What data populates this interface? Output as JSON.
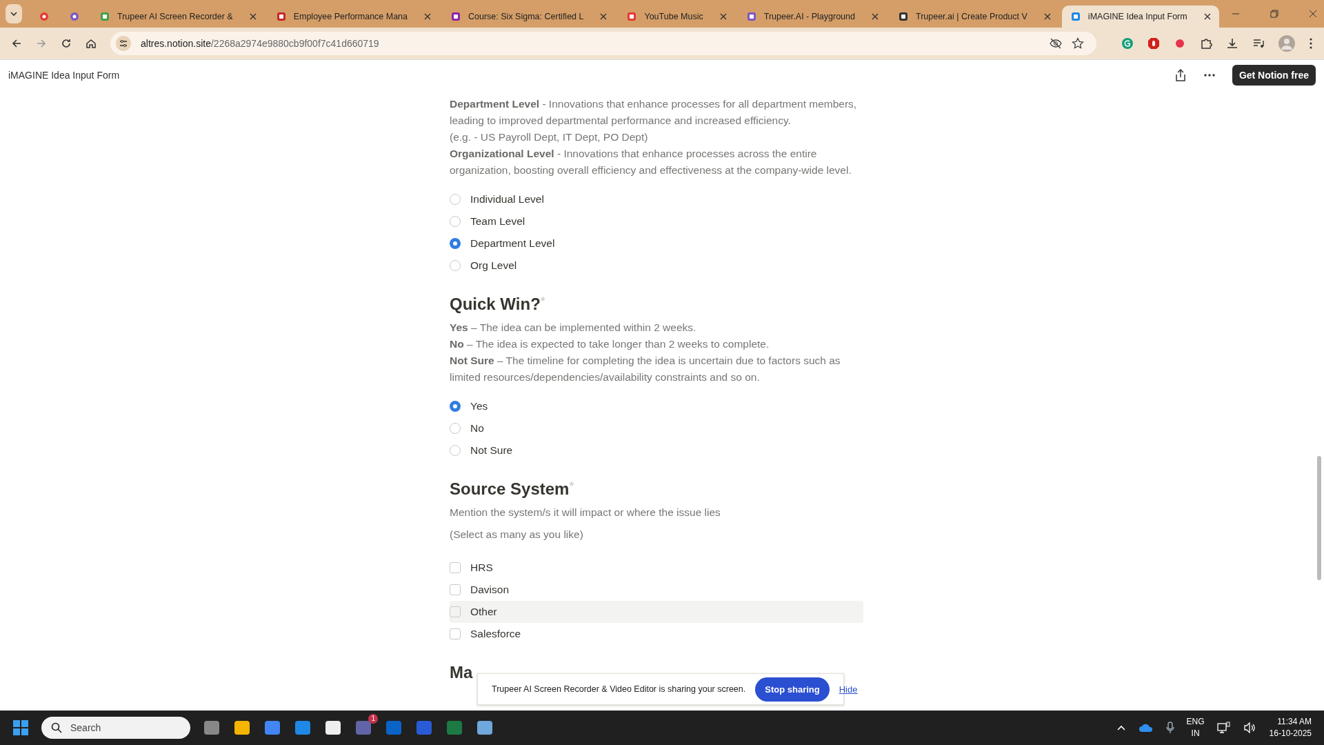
{
  "browser": {
    "tabs": [
      {
        "kind": "pinned",
        "selected": false
      },
      {
        "kind": "pinned",
        "selected": false
      },
      {
        "kind": "normal",
        "title": "Trupeer AI Screen Recorder &",
        "selected": false
      },
      {
        "kind": "normal",
        "title": "Employee Performance Mana",
        "selected": false
      },
      {
        "kind": "normal",
        "title": "Course: Six Sigma: Certified L",
        "selected": false
      },
      {
        "kind": "normal",
        "title": "YouTube Music",
        "selected": false
      },
      {
        "kind": "normal",
        "title": "Trupeer.AI - Playground",
        "selected": false
      },
      {
        "kind": "normal",
        "title": "Trupeer.ai | Create Product V",
        "selected": false
      },
      {
        "kind": "normal",
        "title": "iMAGINE Idea Input Form",
        "selected": true
      }
    ],
    "url_host": "altres.notion.site",
    "url_path": "/2268a2974e9880cb9f00f7c41d660719"
  },
  "page": {
    "title": "iMAGINE Idea Input Form",
    "cta": "Get Notion free"
  },
  "intro": [
    "**Department Level** - Innovations that enhance processes for all department members, leading to improved departmental performance and increased efficiency.",
    "(e.g. - US Payroll Dept, IT Dept, PO Dept)",
    "**Organizational Level** - Innovations that enhance processes across the entire organization, boosting overall efficiency and effectiveness at the company-wide level."
  ],
  "first_options": [
    {
      "label": "Individual Level",
      "selected": false
    },
    {
      "label": "Team Level",
      "selected": false
    },
    {
      "label": "Department Level",
      "selected": true
    },
    {
      "label": "Org Level",
      "selected": false
    }
  ],
  "questions": [
    {
      "kind": "radio",
      "title": "Quick Win?",
      "required_mark": "*",
      "description": [
        "**Yes** – The idea can be implemented within 2 weeks.",
        "**No** – The idea is expected to take longer than 2 weeks to complete.",
        "**Not Sure** – The timeline for completing the idea is uncertain due to factors such as limited resources/dependencies/availability constraints and so on."
      ],
      "options": [
        {
          "label": "Yes",
          "selected": true,
          "hovered": false
        },
        {
          "label": "No",
          "selected": false,
          "hovered": false
        },
        {
          "label": "Not Sure",
          "selected": false,
          "hovered": false
        }
      ]
    },
    {
      "kind": "checkbox",
      "title": "Source System",
      "required_mark": "*",
      "description": [
        "Mention the system/s it will impact or where the issue lies"
      ],
      "hint": "(Select as many as you like)",
      "options": [
        {
          "label": "HRS",
          "checked": false,
          "hovered": false
        },
        {
          "label": "Davison",
          "checked": false,
          "hovered": false
        },
        {
          "label": "Other",
          "checked": false,
          "hovered": true
        },
        {
          "label": "Salesforce",
          "checked": false,
          "hovered": false
        }
      ]
    }
  ],
  "next_heading": "Ma",
  "share_banner": {
    "message": "Trupeer AI Screen Recorder & Video Editor is sharing your screen.",
    "button": "Stop sharing",
    "link": "Hide"
  },
  "taskbar": {
    "search_placeholder": "Search",
    "teams_badge": "1",
    "language": "ENG",
    "region": "IN",
    "time": "11:34 AM",
    "date": "16-10-2025"
  }
}
